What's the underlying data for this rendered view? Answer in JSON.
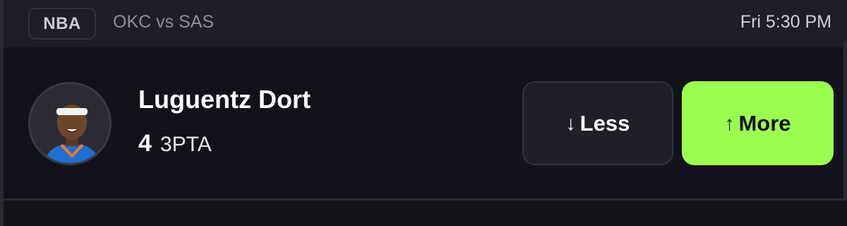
{
  "header": {
    "league": "NBA",
    "matchup": "OKC vs SAS",
    "time": "Fri 5:30 PM"
  },
  "player": {
    "name": "Luguentz Dort",
    "line_value": "4",
    "stat_label": "3PTA"
  },
  "actions": {
    "less_label": "Less",
    "less_icon": "arrow-down-icon",
    "more_label": "More",
    "more_icon": "arrow-up-icon"
  },
  "colors": {
    "background": "#16161d",
    "header_bg": "#1e1e27",
    "more_accent": "#9cff4f"
  }
}
